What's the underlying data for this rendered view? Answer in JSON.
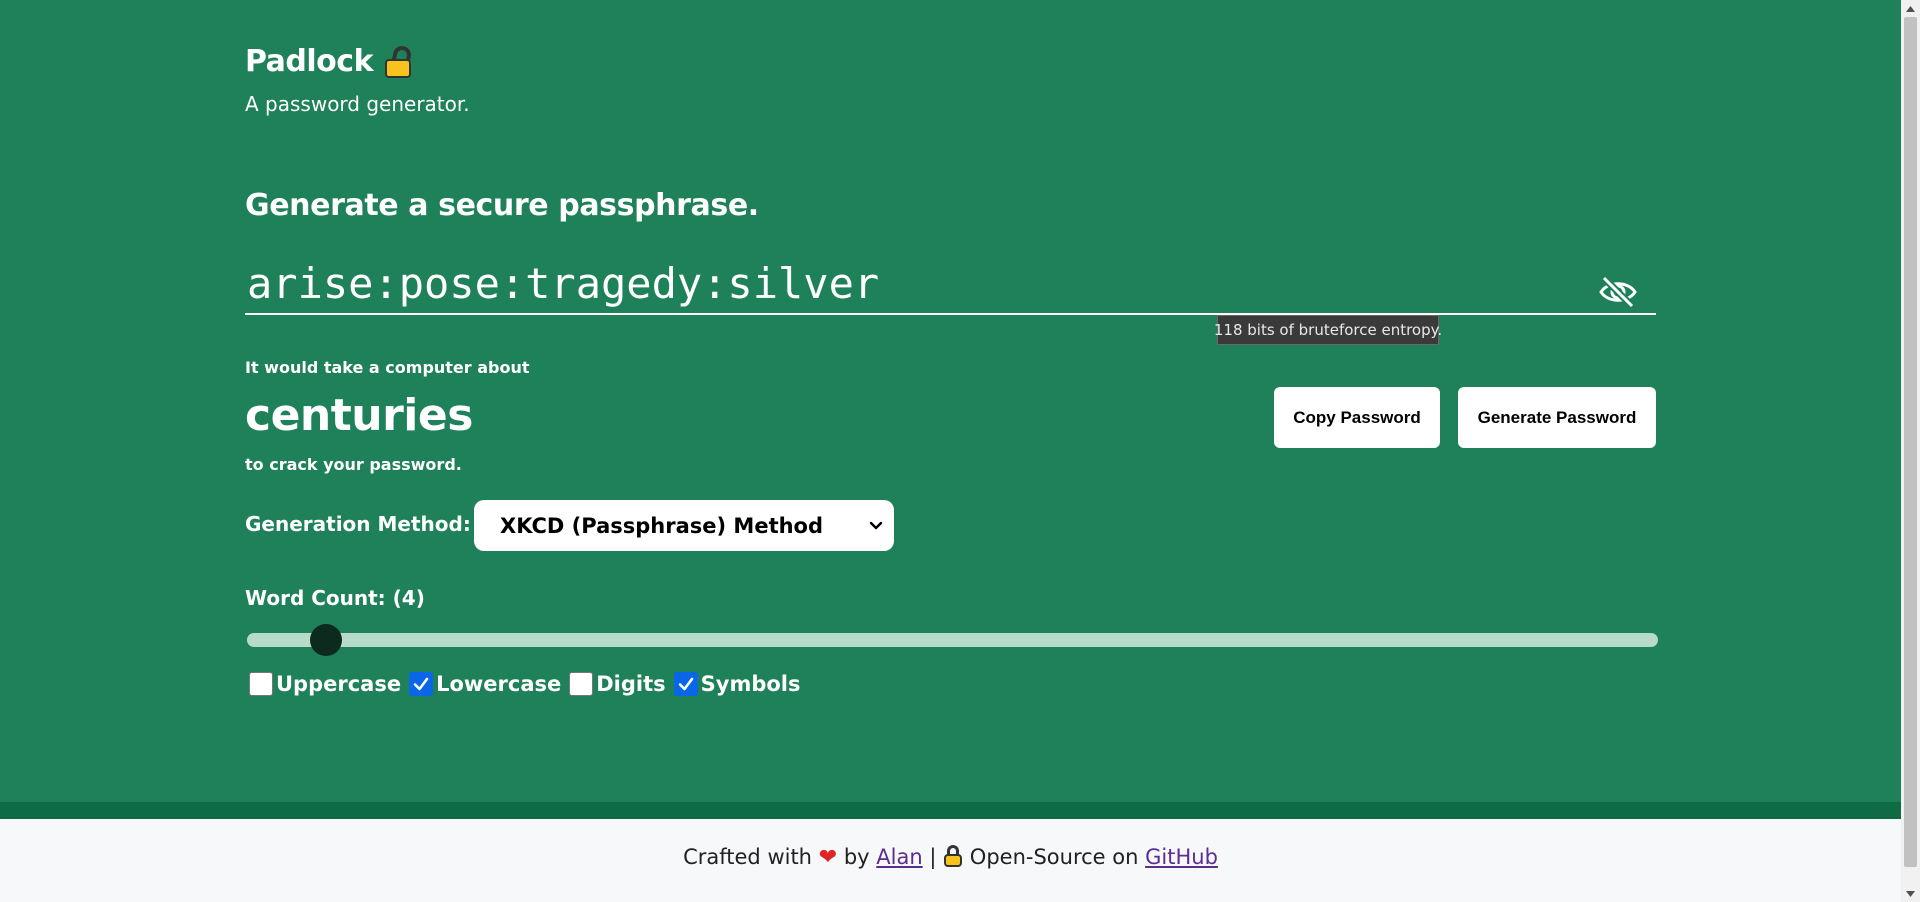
{
  "header": {
    "title": "Padlock",
    "title_icon": "open-padlock-icon",
    "subtitle": "A password generator."
  },
  "generator": {
    "heading": "Generate a secure passphrase.",
    "password": "arise:pose:tragedy:silver",
    "visibility_icon": "eye-slash-icon",
    "tooltip": "118 bits of bruteforce entropy.",
    "crack_pre": "It would take a computer about",
    "crack_time": "centuries",
    "crack_post": "to crack your password.",
    "copy_button": "Copy Password",
    "generate_button": "Generate Password"
  },
  "settings": {
    "method_label": "Generation Method:",
    "method_selected": "XKCD (Passphrase) Method",
    "word_count_label": "Word Count: (4)",
    "word_count_value": 4,
    "slider_position_fraction": 0.045,
    "options": [
      {
        "label": "Uppercase",
        "checked": false
      },
      {
        "label": "Lowercase",
        "checked": true
      },
      {
        "label": "Digits",
        "checked": false
      },
      {
        "label": "Symbols",
        "checked": true
      }
    ]
  },
  "footer": {
    "crafted_with": "Crafted with",
    "heart_icon": "heart-icon",
    "by": "by",
    "author_link": "Alan",
    "separator": "|",
    "lock_icon": "padlock-icon",
    "open_source": "Open-Source on",
    "github_link": "GitHub"
  },
  "colors": {
    "background": "#1e8159",
    "footer_bar": "#0e6b44",
    "footer_bg": "#f7f8fa",
    "checkbox_checked": "#0a66e8",
    "link": "#5a2d91"
  }
}
